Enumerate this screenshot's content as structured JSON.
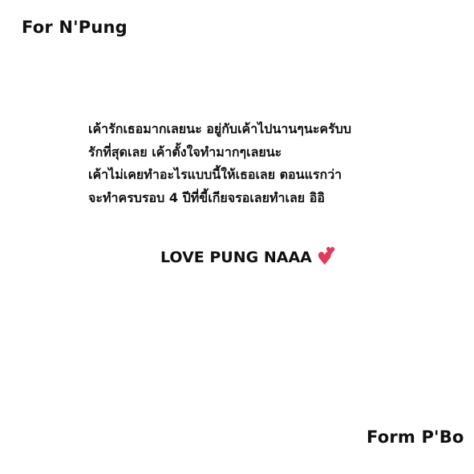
{
  "greeting": "For N'Pung",
  "message_lines": [
    "เค้ารักเธอมากเลยนะ อยู่กับเค้าไปนานๆนะครับบ",
    "รักที่สุดเลย เค้าตั้งใจทำมากๆเลยนะ",
    "เค้าไม่เคยทำอะไรแบบนี้ให้เธอเลย ตอนแรกว่า",
    "จะทำครบรอบ 4 ปีที่ขี้เกียจรอเลยทำเลย อิอิ"
  ],
  "love_text": "LOVE PUNG NAAA",
  "hearts_icon": "two-hearts-icon",
  "heart_color": "#e03a5a",
  "signature": "Form P'Bo"
}
